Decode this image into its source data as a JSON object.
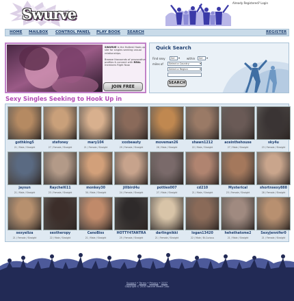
{
  "header": {
    "logo_text": "Swurve",
    "already_registered": "Already Registered? Login"
  },
  "nav": {
    "items": [
      "HOME",
      "MAILBOX",
      "CONTROL PANEL",
      "PLAY BOOK",
      "SEARCH"
    ],
    "register": "REGISTER"
  },
  "hero": {
    "brand": "SWURVE",
    "copy_1": " is the Hottest Hook-up site for singles seeking casual relationships.",
    "copy_2": "Browse thousands of provocative profiles & connect with ",
    "copy_real": "REAL",
    "copy_3": " members Right Now.",
    "join_label": "JOIN FREE"
  },
  "quick_search": {
    "title": "Quick Search",
    "find_sexy": "Find sexy",
    "gender_1": "Sel",
    "within": "within",
    "gender_2": "Sel",
    "miles_of": "miles of",
    "country": "Select a Country",
    "region": "Select a Region",
    "search_label": "SEARCH"
  },
  "section_title": "Sexy Singles Seeking to Hook Up in",
  "profiles": [
    {
      "name": "gothking5",
      "meta": "21 / Male / Straight",
      "tone": "#b58a62"
    },
    {
      "name": "stefoney",
      "meta": "27 / Female / Straight",
      "tone": "#c9a07a"
    },
    {
      "name": "mary104",
      "meta": "21 / Female / Straight",
      "tone": "#d8b08e"
    },
    {
      "name": "xxxbeauty",
      "meta": "29 / Female / Straight",
      "tone": "#8a6a5a"
    },
    {
      "name": "moveman26",
      "meta": "26 / Male / Straight",
      "tone": "#c08850"
    },
    {
      "name": "shawn1212",
      "meta": "22 / Male / Straight",
      "tone": "#9a7a66"
    },
    {
      "name": "aceinthehouse",
      "meta": "27 / Male / Straight",
      "tone": "#6a5a56"
    },
    {
      "name": "sky4u",
      "meta": "23 / Female / Straight",
      "tone": "#3a3434"
    },
    {
      "name": "jaysun",
      "meta": "21 / Male / Straight",
      "tone": "#5a6a82"
    },
    {
      "name": "Raychel611",
      "meta": "23 / Female / Straight",
      "tone": "#b39a88"
    },
    {
      "name": "monkey30",
      "meta": "30 / Male / Straight",
      "tone": "#d2a07a"
    },
    {
      "name": "jillbird4u",
      "meta": "24 / Female / Straight",
      "tone": "#c7a38c"
    },
    {
      "name": "potties007",
      "meta": "27 / Male / Straight",
      "tone": "#7a6a6a"
    },
    {
      "name": "cd210",
      "meta": "21 / Male / Straight",
      "tone": "#b08470"
    },
    {
      "name": "Mysterical",
      "meta": "23 / Female / Straight",
      "tone": "#a4785c"
    },
    {
      "name": "shortnsexy888",
      "meta": "28 / Female / Straight",
      "tone": "#c9a58c"
    },
    {
      "name": "sexyeliza",
      "meta": "21 / Female / Straight",
      "tone": "#b7906e"
    },
    {
      "name": "sextheropy",
      "meta": "22 / Male / Straight",
      "tone": "#3c2e2a"
    },
    {
      "name": "CanoBiss",
      "meta": "21 / Male / Straight",
      "tone": "#c08a6a"
    },
    {
      "name": "HOTTY4TANTRA",
      "meta": "25 / Female / Straight",
      "tone": "#2e2a2a"
    },
    {
      "name": "darlingnikki",
      "meta": "21 / Female / Straight",
      "tone": "#d8c4a8"
    },
    {
      "name": "logan13420",
      "meta": "22 / Male / Bi-Curious",
      "tone": "#8a6a58"
    },
    {
      "name": "hehethatsme2",
      "meta": "21 / Male / Straight",
      "tone": "#a08a80"
    },
    {
      "name": "SexyJennifer0",
      "meta": "21 / Female / Straight",
      "tone": "#b89070"
    }
  ],
  "footer": {
    "links": [
      "Support",
      "Terms",
      "Privacy",
      "2257"
    ],
    "copyright": "Copyright © 2010 Swurve Media Corp"
  },
  "colors": {
    "nav_bg": "#c9dbe9",
    "accent_pink": "#b24bb5",
    "link_blue": "#1f3f6f",
    "footer_bg": "#222a55"
  }
}
